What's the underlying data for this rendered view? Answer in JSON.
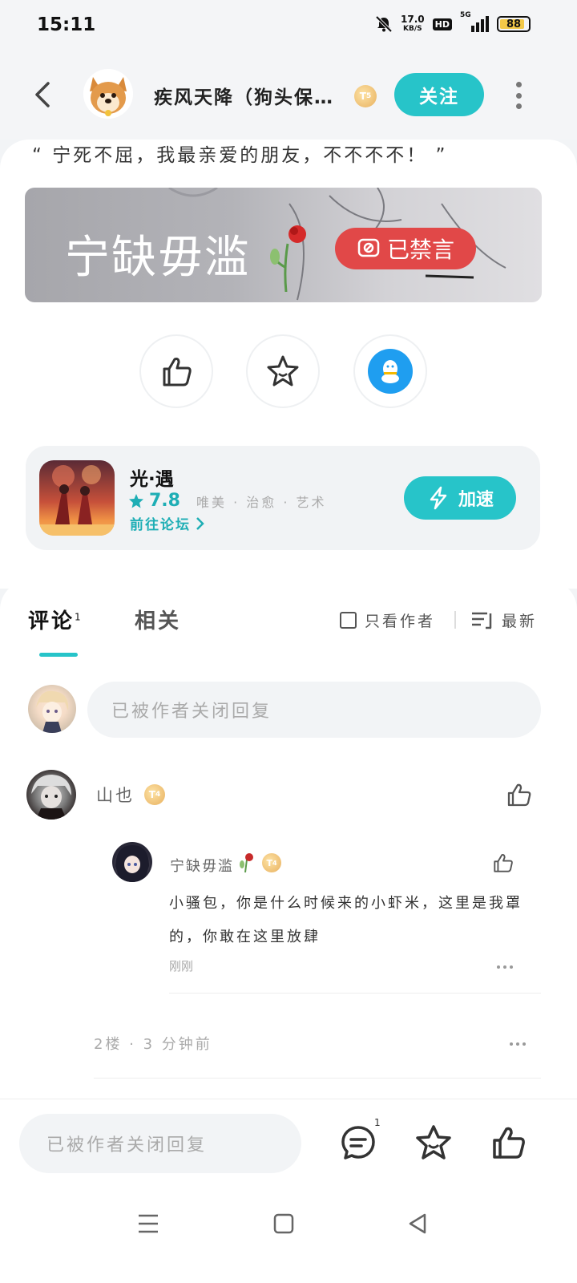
{
  "status": {
    "time": "15:11",
    "net_speed_value": "17.0",
    "net_speed_unit": "KB/S",
    "hd": "HD",
    "network": "5G",
    "battery": "88",
    "battery_level": 0.88
  },
  "header": {
    "name": "疾风天降（狗头保…",
    "level": "5",
    "follow_label": "关注"
  },
  "post": {
    "quote": "“ 宁死不屈，我最亲爱的朋友，不不不不！ ”",
    "banner_title": "宁缺毋滥",
    "banner_badge": "已禁言"
  },
  "game": {
    "name": "光·遇",
    "rating": "7.8",
    "tags": [
      "唯美",
      "治愈",
      "艺术"
    ],
    "forum_link": "前往论坛",
    "speed_label": "加速"
  },
  "comments": {
    "tab_comments": "评论",
    "tab_comments_count": "1",
    "tab_related": "相关",
    "author_only": "只看作者",
    "sort": "最新",
    "reply_placeholder": "已被作者关闭回复",
    "items": [
      {
        "name": "山也",
        "level": "4",
        "floor_meta": "2楼 · 3 分钟前",
        "reply": {
          "name": "宁缺毋滥",
          "level": "4",
          "text": "小骚包，你是什么时候来的小虾米，这里是我罩的，你敢在这里放肆",
          "time": "刚刚"
        }
      }
    ]
  },
  "bottom": {
    "input_placeholder": "已被作者关闭回复",
    "comment_count": "1"
  },
  "colors": {
    "accent": "#27c4c9",
    "muted_badge": "#e14848",
    "level_badge": "#e8b05e",
    "qq_blue": "#1f9ef0"
  }
}
